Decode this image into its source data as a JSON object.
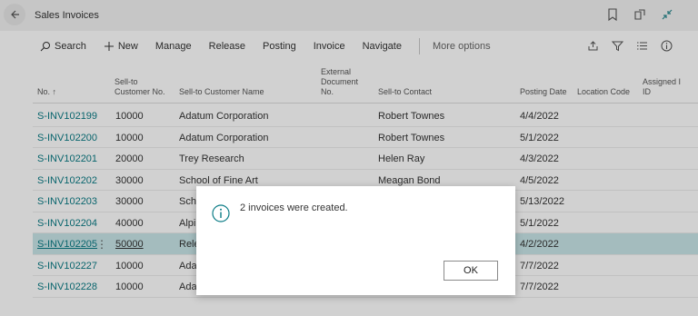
{
  "page": {
    "title": "Sales Invoices"
  },
  "actions": {
    "search": "Search",
    "new": "New",
    "manage": "Manage",
    "release": "Release",
    "posting": "Posting",
    "invoice": "Invoice",
    "navigate": "Navigate",
    "more_options": "More options"
  },
  "columns": {
    "no": "No. ↑",
    "sell_to_customer_no_1": "Sell-to",
    "sell_to_customer_no_2": "Customer No.",
    "sell_to_customer_name": "Sell-to Customer Name",
    "external_doc_1": "External",
    "external_doc_2": "Document",
    "external_doc_3": "No.",
    "sell_to_contact": "Sell-to Contact",
    "posting_date": "Posting Date",
    "location_code": "Location Code",
    "assigned_1": "Assigned I",
    "assigned_2": "ID"
  },
  "rows": [
    {
      "no": "S-INV102199",
      "cust_no": "10000",
      "name": "Adatum Corporation",
      "contact": "Robert Townes",
      "date": "4/4/2022"
    },
    {
      "no": "S-INV102200",
      "cust_no": "10000",
      "name": "Adatum Corporation",
      "contact": "Robert Townes",
      "date": "5/1/2022"
    },
    {
      "no": "S-INV102201",
      "cust_no": "20000",
      "name": "Trey Research",
      "contact": "Helen Ray",
      "date": "4/3/2022"
    },
    {
      "no": "S-INV102202",
      "cust_no": "30000",
      "name": "School of Fine Art",
      "contact": "Meagan Bond",
      "date": "4/5/2022"
    },
    {
      "no": "S-INV102203",
      "cust_no": "30000",
      "name": "Scho",
      "contact": "",
      "date": "5/13/2022"
    },
    {
      "no": "S-INV102204",
      "cust_no": "40000",
      "name": "Alpi",
      "contact": "",
      "date": "5/1/2022"
    },
    {
      "no": "S-INV102205",
      "cust_no": "50000",
      "name": "Rele",
      "contact": "",
      "date": "4/2/2022"
    },
    {
      "no": "S-INV102227",
      "cust_no": "10000",
      "name": "Ada",
      "contact": "",
      "date": "7/7/2022"
    },
    {
      "no": "S-INV102228",
      "cust_no": "10000",
      "name": "Ada",
      "contact": "",
      "date": "7/7/2022"
    }
  ],
  "dialog": {
    "message": "2 invoices were created.",
    "ok": "OK"
  }
}
